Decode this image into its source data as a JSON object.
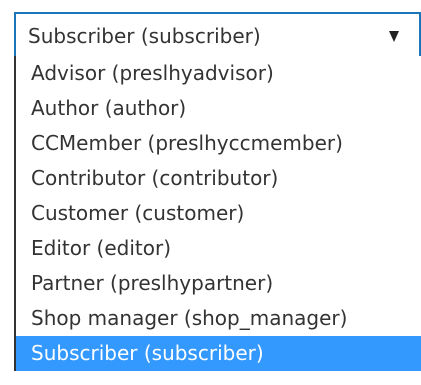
{
  "select": {
    "value": "Subscriber (subscriber)",
    "arrow_icon": "dropdown-arrow-icon"
  },
  "options": [
    {
      "label": "Advisor (preslhyadvisor)",
      "selected": false
    },
    {
      "label": "Author (author)",
      "selected": false
    },
    {
      "label": "CCMember (preslhyccmember)",
      "selected": false
    },
    {
      "label": "Contributor (contributor)",
      "selected": false
    },
    {
      "label": "Customer (customer)",
      "selected": false
    },
    {
      "label": "Editor (editor)",
      "selected": false
    },
    {
      "label": "Partner (preslhypartner)",
      "selected": false
    },
    {
      "label": "Shop manager (shop_manager)",
      "selected": false
    },
    {
      "label": "Subscriber (subscriber)",
      "selected": true
    }
  ],
  "colors": {
    "focus_border": "#1b75bb",
    "highlight": "#3399ff",
    "text": "#333333"
  }
}
